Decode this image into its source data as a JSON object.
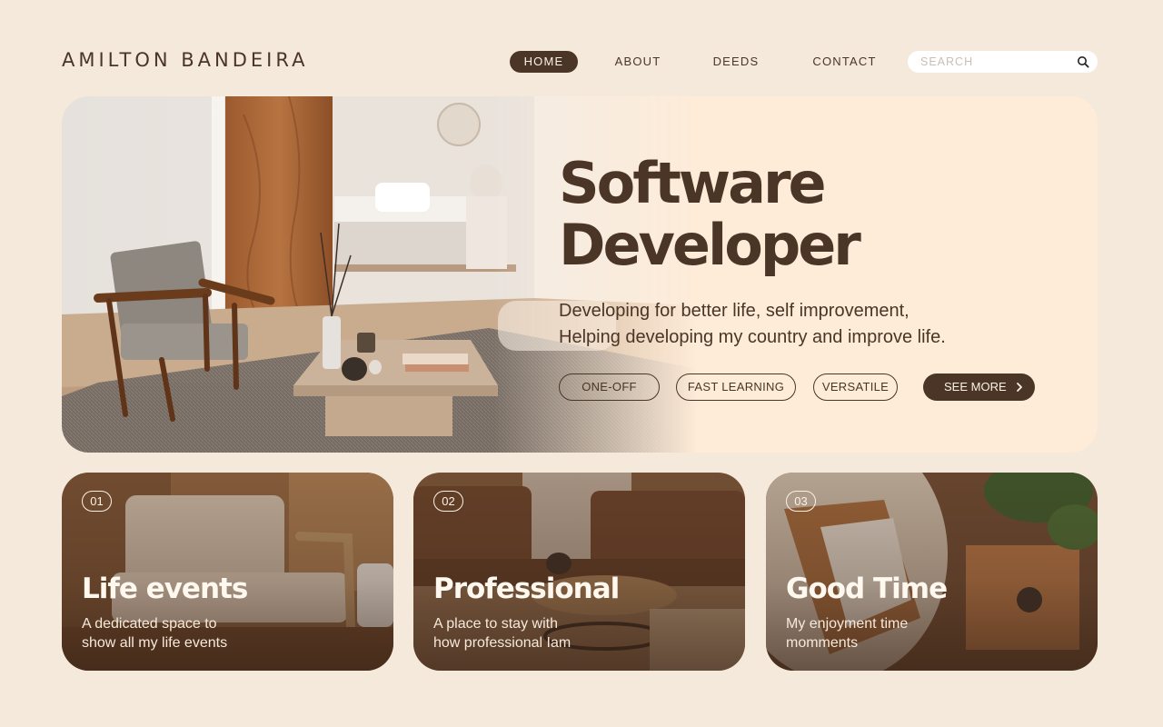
{
  "brand": "AMILTON BANDEIRA",
  "nav": {
    "items": [
      {
        "label": "HOME",
        "active": true
      },
      {
        "label": "ABOUT",
        "active": false
      },
      {
        "label": "DEEDS",
        "active": false
      },
      {
        "label": "CONTACT",
        "active": false
      }
    ]
  },
  "search": {
    "placeholder": "SEARCH",
    "value": "",
    "icon": "search-icon"
  },
  "hero": {
    "title_line1": "Software",
    "title_line2": "Developer",
    "subtitle_line1": "Developing for better life, self improvement,",
    "subtitle_line2": "Helping developing my country and improve life.",
    "tags": [
      "ONE-OFF",
      "FAST LEARNING",
      "VERSATILE"
    ],
    "cta": {
      "label": "SEE MORE",
      "icon": "chevron-right-icon"
    }
  },
  "cards": [
    {
      "number": "01",
      "title": "Life events",
      "description_line1": "A dedicated space to",
      "description_line2": "show all my life events"
    },
    {
      "number": "02",
      "title": "Professional",
      "description_line1": "A place to stay with",
      "description_line2": "how professional Iam"
    },
    {
      "number": "03",
      "title": "Good Time",
      "description_line1": "My enjoyment time",
      "description_line2": "momments"
    }
  ],
  "colors": {
    "background": "#f5e9dc",
    "hero_panel": "#feecd9",
    "accent_dark": "#4a3527",
    "light_text": "#fbf1e6"
  }
}
